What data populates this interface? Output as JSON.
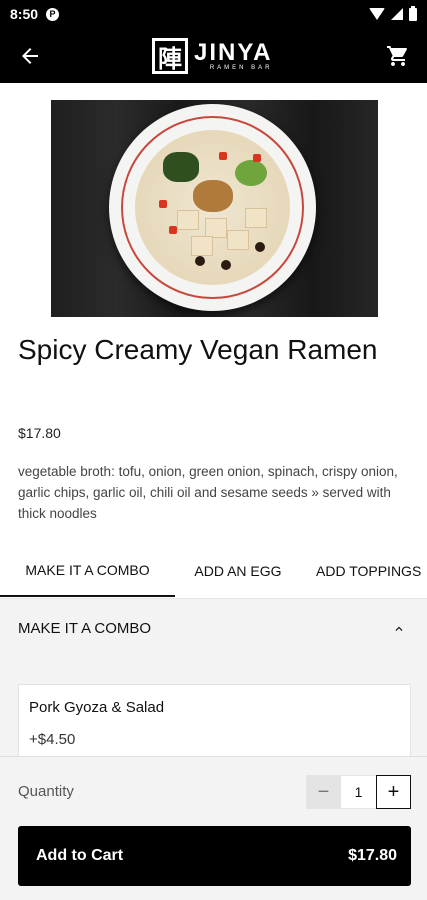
{
  "status_bar": {
    "time": "8:50",
    "app_icon": "P",
    "icons": [
      "wifi-icon",
      "signal-icon",
      "battery-icon"
    ]
  },
  "header": {
    "back_icon": "arrow-left-icon",
    "logo_kanji": "陣",
    "logo_word": "JINYA",
    "logo_sub": "RAMEN BAR",
    "cart_icon": "cart-icon"
  },
  "product": {
    "title": "Spicy Creamy Vegan Ramen",
    "price": "$17.80",
    "description": "vegetable broth: tofu, onion, green onion, spinach, crispy onion, garlic chips, garlic oil, chili oil and sesame seeds » served with thick noodles"
  },
  "tabs": [
    {
      "label": "MAKE IT A COMBO",
      "active": true
    },
    {
      "label": "ADD AN EGG",
      "active": false
    },
    {
      "label": "ADD TOPPINGS",
      "active": false
    }
  ],
  "section": {
    "title": "MAKE IT A COMBO",
    "options": [
      {
        "name": "Pork Gyoza & Salad",
        "price": "+$4.50"
      }
    ]
  },
  "bottom_bar": {
    "quantity_label": "Quantity",
    "quantity_value": "1",
    "minus": "−",
    "plus": "+",
    "add_to_cart_label": "Add to Cart",
    "add_to_cart_price": "$17.80"
  },
  "colors": {
    "header_bg": "#000000",
    "accent": "#000000",
    "section_bg": "#f3f3f3"
  }
}
